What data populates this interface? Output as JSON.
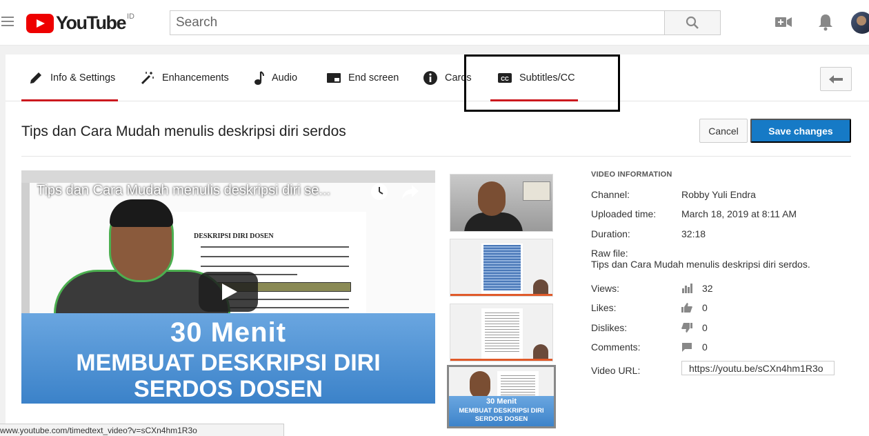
{
  "header": {
    "logo_text": "YouTube",
    "logo_country": "ID",
    "search_placeholder": "Search"
  },
  "tabs": [
    {
      "label": "Info & Settings",
      "icon": "pencil-icon",
      "active": true
    },
    {
      "label": "Enhancements",
      "icon": "magic-wand-icon",
      "active": false
    },
    {
      "label": "Audio",
      "icon": "music-note-icon",
      "active": false
    },
    {
      "label": "End screen",
      "icon": "end-screen-icon",
      "active": false
    },
    {
      "label": "Cards",
      "icon": "info-circle-icon",
      "active": false
    },
    {
      "label": "Subtitles/CC",
      "icon": "cc-icon",
      "active": true
    }
  ],
  "video": {
    "title": "Tips dan Cara Mudah menulis deskripsi diri serdos",
    "cancel_label": "Cancel",
    "save_label": "Save changes"
  },
  "player": {
    "overlay_title": "Tips dan Cara Mudah menulis deskripsi diri se...",
    "doc_heading": "DESKRIPSI DIRI DOSEN",
    "banner_line1": "30 Menit",
    "banner_line2": "MEMBUAT DESKRIPSI DIRI",
    "banner_line3": "SERDOS DOSEN"
  },
  "thumbnail_banner": {
    "line1": "30 Menit",
    "line2": "MEMBUAT DESKRIPSI DIRI",
    "line3": "SERDOS DOSEN"
  },
  "info": {
    "heading": "VIDEO INFORMATION",
    "channel_label": "Channel:",
    "channel_value": "Robby Yuli Endra",
    "uploaded_label": "Uploaded time:",
    "uploaded_value": "March 18, 2019 at 8:11 AM",
    "duration_label": "Duration:",
    "duration_value": "32:18",
    "raw_file_label": "Raw file:",
    "raw_file_value": "Tips dan Cara Mudah menulis deskripsi diri serdos.",
    "views_label": "Views:",
    "views_value": "32",
    "likes_label": "Likes:",
    "likes_value": "0",
    "dislikes_label": "Dislikes:",
    "dislikes_value": "0",
    "comments_label": "Comments:",
    "comments_value": "0",
    "url_label": "Video URL:",
    "url_value": "https://youtu.be/sCXn4hm1R3o"
  },
  "statusbar": {
    "text": "www.youtube.com/timedtext_video?v=sCXn4hm1R3o"
  },
  "colors": {
    "brand_red": "#e00000",
    "tab_underline": "#cc181e",
    "save_blue": "#167ac6"
  }
}
